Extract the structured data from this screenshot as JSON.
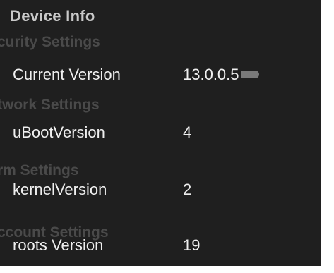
{
  "header": {
    "title": "Device Info"
  },
  "ghost_headers": [
    "curity Settings",
    "twork Settings",
    "rm Settings",
    "ccount Settings"
  ],
  "rows": [
    {
      "label": "Current Version",
      "value": "13.0.0.5"
    },
    {
      "label": "uBootVersion",
      "value": "4"
    },
    {
      "label": "kernelVersion",
      "value": "2"
    },
    {
      "label": "roots Version",
      "value": "19"
    }
  ]
}
